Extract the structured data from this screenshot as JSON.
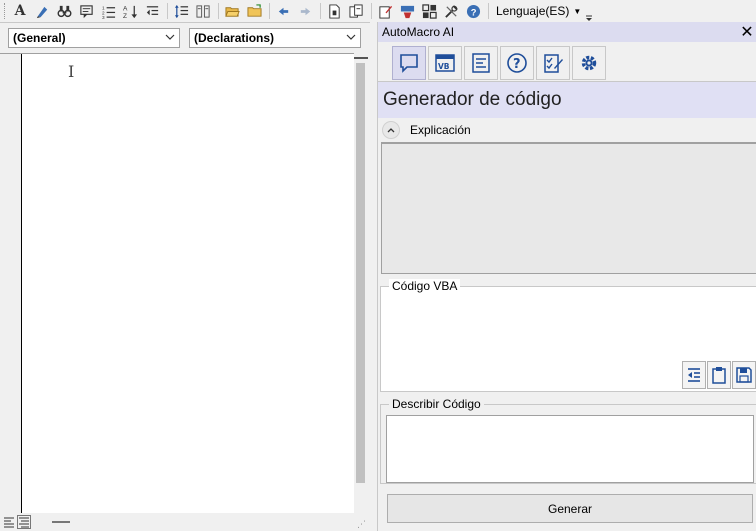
{
  "toolbar": {
    "language_label": "Lenguaje(ES)"
  },
  "editor": {
    "object_combo_value": "(General)",
    "procedure_combo_value": "(Declarations)"
  },
  "panel": {
    "title": "AutoMacro AI",
    "section_title": "Generador de código",
    "explanation_label": "Explicación",
    "vba_code_label": "Código VBA",
    "describe_code_label": "Describir Código",
    "generate_button_label": "Generar"
  },
  "colors": {
    "panel_title_bg": "#dcdcf0",
    "section_title_bg": "#e0e0f4",
    "icon_blue": "#1f4e9a"
  }
}
